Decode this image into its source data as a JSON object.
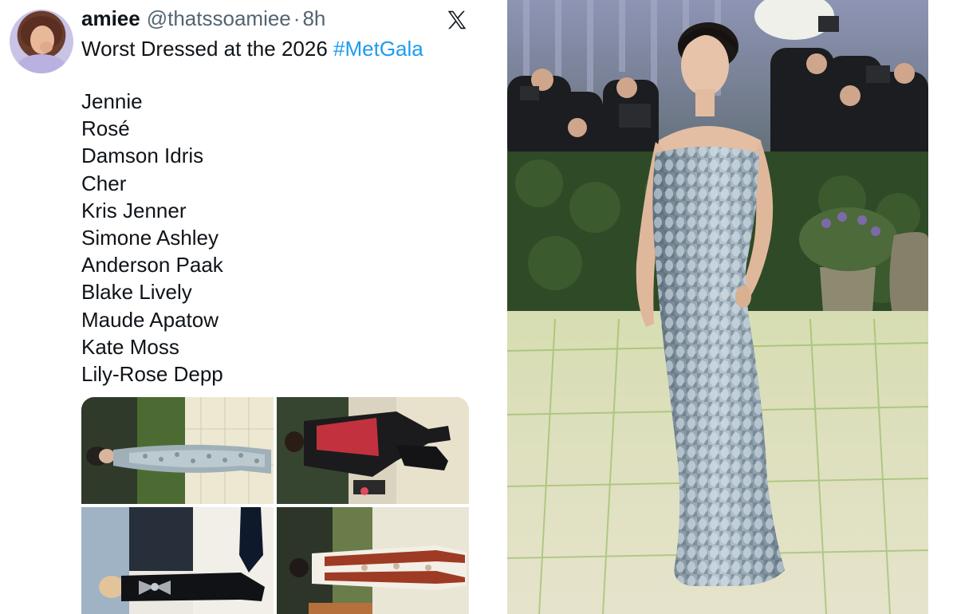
{
  "tweet": {
    "author": {
      "display_name": "amiee",
      "handle": "@thatssoamiee",
      "separator": "·",
      "time": "8h"
    },
    "text_prefix": "Worst Dressed at the 2026 ",
    "hashtag": "#MetGala",
    "names": [
      "Jennie",
      "Rosé",
      "Damson Idris",
      "Cher",
      "Kris Jenner",
      "Simone Ashley",
      "Anderson Paak",
      "Blake Lively",
      "Maude Apatow",
      "Kate Moss",
      "Lily-Rose Depp"
    ],
    "media_count": 4,
    "icons": {
      "platform": "x-logo-icon"
    }
  },
  "colors": {
    "text": "#0f1419",
    "secondary_text": "#536471",
    "link": "#1d9bf0",
    "background": "#ffffff"
  }
}
